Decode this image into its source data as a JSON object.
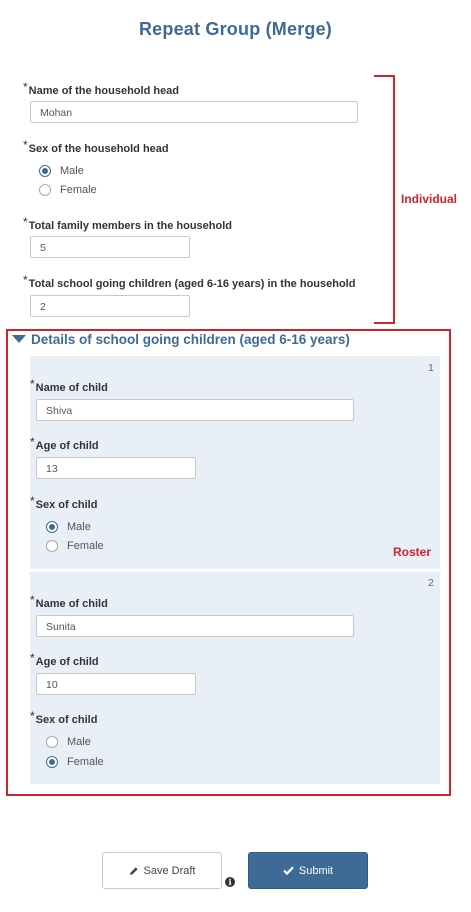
{
  "form": {
    "title": "Repeat Group (Merge)"
  },
  "individual": {
    "q_head_name": {
      "label": "Name of the household head",
      "required": "*",
      "value": "Mohan"
    },
    "q_head_sex": {
      "label": "Sex of the household head",
      "required": "*",
      "options": [
        "Male",
        "Female"
      ],
      "selected": "Male"
    },
    "q_family_members": {
      "label": "Total family members in the household",
      "required": "*",
      "value": "5"
    },
    "q_school_children": {
      "label": "Total school going children (aged 6-16 years) in the household",
      "required": "*",
      "value": "2"
    }
  },
  "annotations": {
    "individual": "Individual",
    "roster": "Roster"
  },
  "roster": {
    "title": "Details of school going children (aged 6-16 years)",
    "repeats": [
      {
        "number": "1",
        "name_label": "Name of child",
        "name_value": "Shiva",
        "age_label": "Age of child",
        "age_value": "13",
        "sex_label": "Sex of child",
        "options": [
          "Male",
          "Female"
        ],
        "selected": "Male",
        "required": "*"
      },
      {
        "number": "2",
        "name_label": "Name of child",
        "name_value": "Sunita",
        "age_label": "Age of child",
        "age_value": "10",
        "sex_label": "Sex of child",
        "options": [
          "Male",
          "Female"
        ],
        "selected": "Female",
        "required": "*"
      }
    ]
  },
  "footer": {
    "save_draft_label": "Save Draft",
    "submit_label": "Submit",
    "info_glyph": "i"
  },
  "colors": {
    "accent": "#3e6a96",
    "annotation": "#d0232a",
    "repeat_bg": "#e9eff6"
  },
  "icons": [
    "pencil-icon",
    "check-icon",
    "info-icon",
    "collapse-triangle-icon"
  ]
}
